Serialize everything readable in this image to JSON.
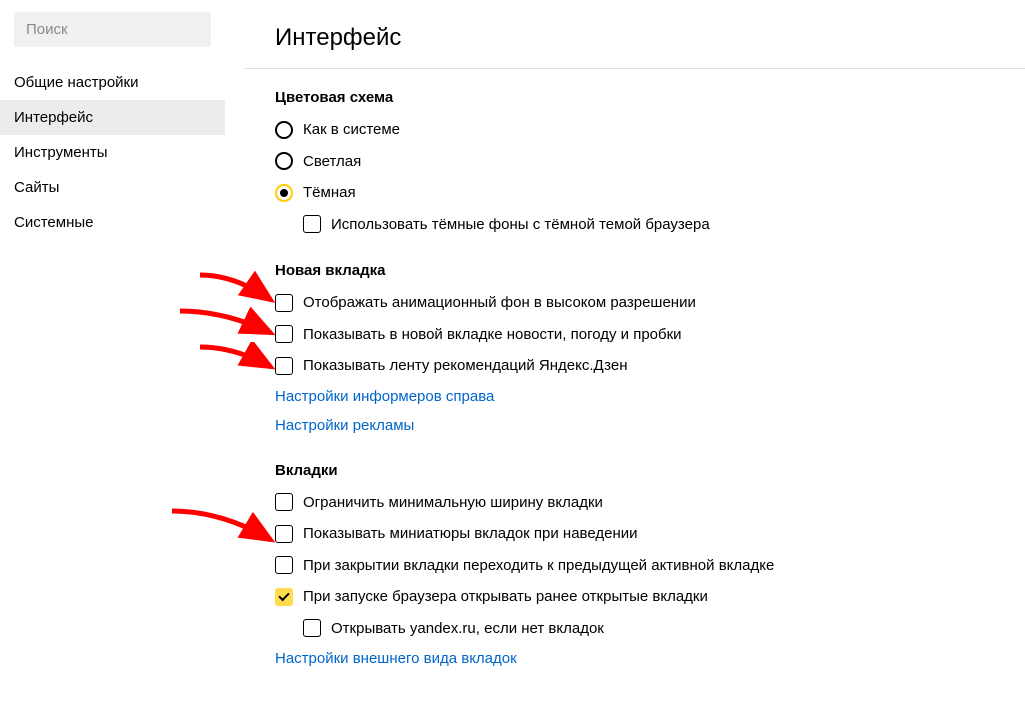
{
  "sidebar": {
    "search_placeholder": "Поиск",
    "items": [
      {
        "label": "Общие настройки"
      },
      {
        "label": "Интерфейс"
      },
      {
        "label": "Инструменты"
      },
      {
        "label": "Сайты"
      },
      {
        "label": "Системные"
      }
    ],
    "active_index": 1
  },
  "page": {
    "title": "Интерфейс"
  },
  "sections": {
    "color_scheme": {
      "title": "Цветовая схема",
      "radios": [
        {
          "label": "Как в системе"
        },
        {
          "label": "Светлая"
        },
        {
          "label": "Тёмная"
        }
      ],
      "selected_index": 2,
      "dark_backgrounds": {
        "label": "Использовать тёмные фоны с тёмной темой браузера",
        "checked": false
      }
    },
    "new_tab": {
      "title": "Новая вкладка",
      "items": [
        {
          "label": "Отображать анимационный фон в высоком разрешении",
          "checked": false
        },
        {
          "label": "Показывать в новой вкладке новости, погоду и пробки",
          "checked": false
        },
        {
          "label": "Показывать ленту рекомендаций Яндекс.Дзен",
          "checked": false
        }
      ],
      "links": [
        "Настройки информеров справа",
        "Настройки рекламы"
      ]
    },
    "tabs": {
      "title": "Вкладки",
      "items": [
        {
          "label": "Ограничить минимальную ширину вкладки",
          "checked": false
        },
        {
          "label": "Показывать миниатюры вкладок при наведении",
          "checked": false
        },
        {
          "label": "При закрытии вкладки переходить к предыдущей активной вкладке",
          "checked": false
        },
        {
          "label": "При запуске браузера открывать ранее открытые вкладки",
          "checked": true
        }
      ],
      "sub_item": {
        "label": "Открывать yandex.ru, если нет вкладок",
        "checked": false
      },
      "links": [
        "Настройки внешнего вида вкладок"
      ]
    }
  }
}
